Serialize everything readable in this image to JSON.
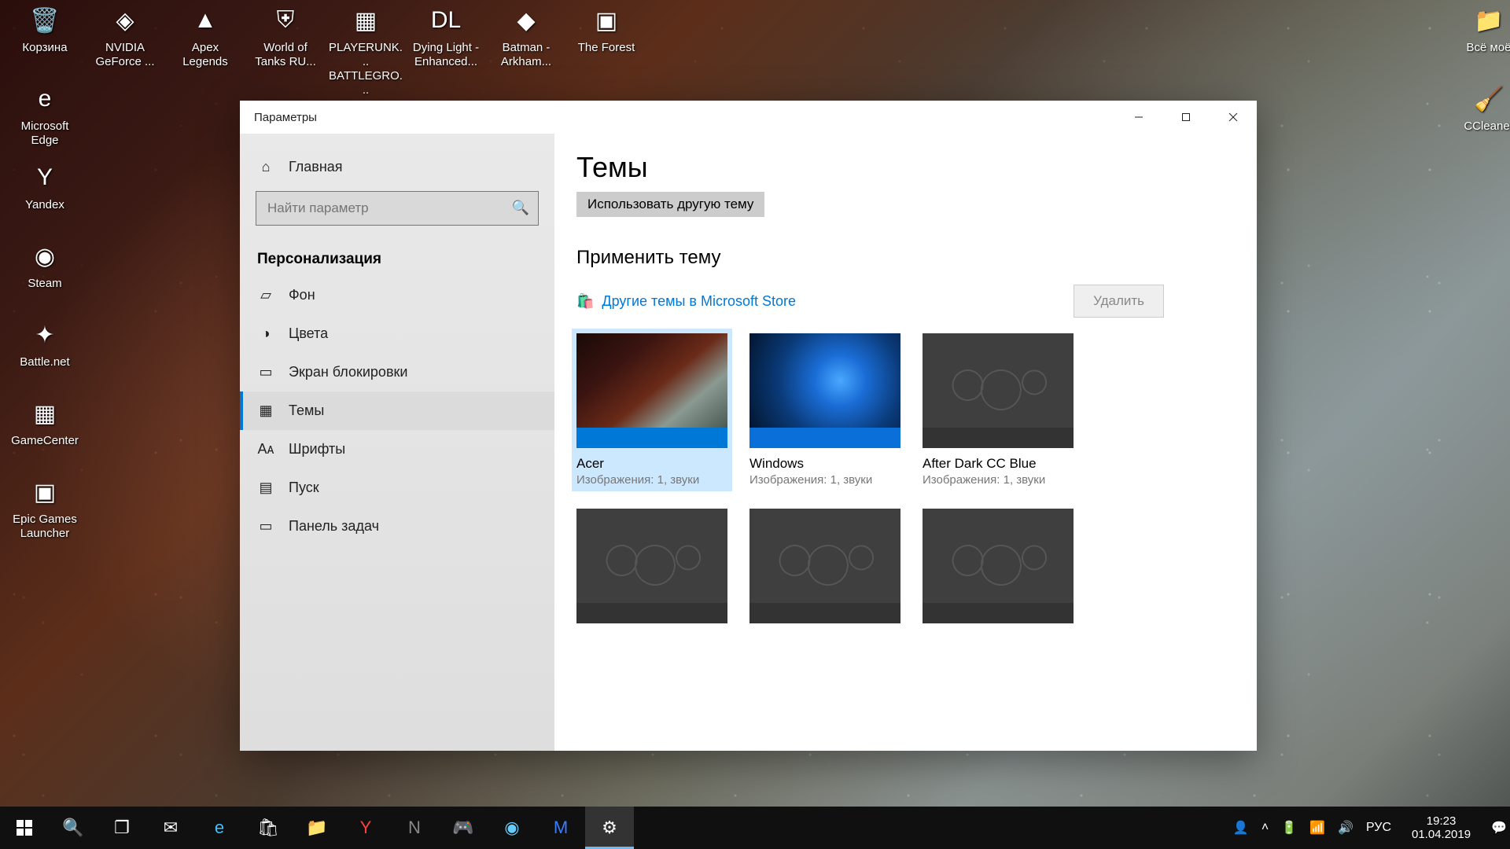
{
  "desktop_icons": [
    {
      "label": "Корзина",
      "col": 0,
      "row": 0,
      "glyph": "🗑️"
    },
    {
      "label": "NVIDIA GeForce ...",
      "col": 1,
      "row": 0,
      "glyph": "◈"
    },
    {
      "label": "Apex Legends",
      "col": 2,
      "row": 0,
      "glyph": "▲"
    },
    {
      "label": "World of Tanks RU...",
      "col": 3,
      "row": 0,
      "glyph": "⛨"
    },
    {
      "label": "PLAYERUNK... BATTLEGRO...",
      "col": 4,
      "row": 0,
      "glyph": "▦"
    },
    {
      "label": "Dying Light - Enhanced...",
      "col": 5,
      "row": 0,
      "glyph": "DL"
    },
    {
      "label": "Batman - Arkham...",
      "col": 6,
      "row": 0,
      "glyph": "◆"
    },
    {
      "label": "The Forest",
      "col": 7,
      "row": 0,
      "glyph": "▣"
    },
    {
      "label": "Microsoft Edge",
      "col": 0,
      "row": 1,
      "glyph": "e"
    },
    {
      "label": "Yandex",
      "col": 0,
      "row": 2,
      "glyph": "Y"
    },
    {
      "label": "Steam",
      "col": 0,
      "row": 3,
      "glyph": "◉"
    },
    {
      "label": "Battle.net",
      "col": 0,
      "row": 4,
      "glyph": "✦"
    },
    {
      "label": "GameCenter",
      "col": 0,
      "row": 5,
      "glyph": "▦"
    },
    {
      "label": "Epic Games Launcher",
      "col": 0,
      "row": 6,
      "glyph": "▣"
    },
    {
      "label": "Всё моё",
      "col": 18,
      "row": 0,
      "glyph": "📁"
    },
    {
      "label": "CCleaner",
      "col": 18,
      "row": 1,
      "glyph": "🧹"
    }
  ],
  "window": {
    "title": "Параметры",
    "sidebar": {
      "home": "Главная",
      "search_placeholder": "Найти параметр",
      "section": "Персонализация",
      "items": [
        {
          "label": "Фон",
          "glyph": "▱"
        },
        {
          "label": "Цвета",
          "glyph": "◑"
        },
        {
          "label": "Экран блокировки",
          "glyph": "▭"
        },
        {
          "label": "Темы",
          "glyph": "▦",
          "selected": true
        },
        {
          "label": "Шрифты",
          "glyph": "Aᴀ"
        },
        {
          "label": "Пуск",
          "glyph": "▤"
        },
        {
          "label": "Панель задач",
          "glyph": "▭"
        }
      ]
    },
    "main": {
      "heading": "Темы",
      "use_other": "Использовать другую тему",
      "apply_heading": "Применить тему",
      "store_link": "Другие темы в Microsoft Store",
      "delete": "Удалить",
      "themes": [
        {
          "name": "Acer",
          "desc": "Изображения: 1, звуки",
          "cls": "acer",
          "selected": true
        },
        {
          "name": "Windows",
          "desc": "Изображения: 1, звуки",
          "cls": "windows"
        },
        {
          "name": "After Dark CC Blue",
          "desc": "Изображения: 1, звуки",
          "cls": "dark"
        },
        {
          "name": "",
          "desc": "",
          "cls": "dark"
        },
        {
          "name": "",
          "desc": "",
          "cls": "dark"
        },
        {
          "name": "",
          "desc": "",
          "cls": "dark"
        }
      ]
    }
  },
  "taskbar": {
    "tray": {
      "lang": "РУС",
      "time": "19:23",
      "date": "01.04.2019"
    }
  }
}
